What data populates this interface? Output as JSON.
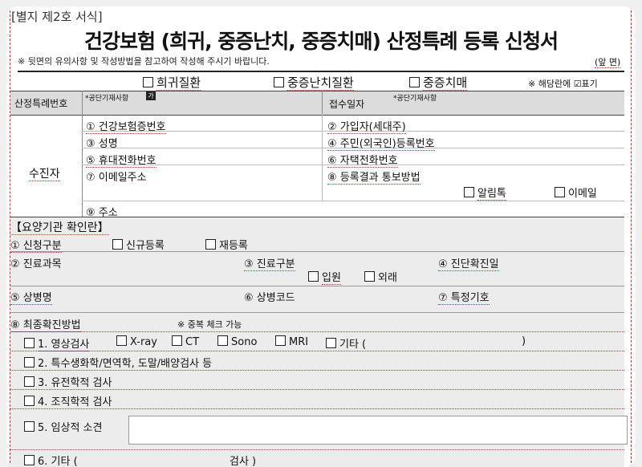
{
  "form_label": "[별지 제2호 서식]",
  "title": "건강보험 (희귀, 중증난치, 중증치매) 산정특례 등록 신청서",
  "note": "※ 뒷면의 유의사항 및 작성방법을 참고하여 작성해 주시기 바랍니다.",
  "page_side": "(앞 면)",
  "disease_types": [
    "희귀질환",
    "중증난치질환",
    "중증치매"
  ],
  "check_hint": "※ 해당란에 ☑표기",
  "special_case_no_label": "산정특례번호",
  "public_entry_1": "*공단기재사항",
  "receipt_date_label": "접수일자",
  "public_entry_2": "*공단기재사항",
  "recipient_label": "수진자",
  "fields": {
    "f1": "① 건강보험증번호",
    "f2": "② 가입자(세대주)",
    "f3": "③ 성명",
    "f4": "④ 주민(외국인)등록번호",
    "f5": "⑤ 휴대전화번호",
    "f6": "⑥ 자택전화번호",
    "f7": "⑦ 이메일주소",
    "f8": "⑧ 등록결과 통보방법",
    "f8_opt1": "알림톡",
    "f8_opt2": "이메일",
    "f9": "⑨ 주소"
  },
  "clinic_section": "【요양기관 확인란】",
  "clinic": {
    "req_type": "① 신청구분",
    "new_reg": "신규등록",
    "re_reg": "재등록",
    "dept": "② 진료과목",
    "care_type": "③ 진료구분",
    "inpatient": "입원",
    "outpatient": "외래",
    "diag_date": "④ 진단확진일",
    "disease_name": "⑤ 상병명",
    "disease_code": "⑥ 상병코드",
    "special_symbol": "⑦ 특정기호",
    "confirm_method": "⑧ 최종확진방법",
    "multi_check": "※ 중복 체크 가능"
  },
  "methods": {
    "m1": "1. 영상검사",
    "m1_opts": [
      "X-ray",
      "CT",
      "Sono",
      "MRI"
    ],
    "m1_etc": "기타 (",
    "m1_close": ")",
    "m2": "2. 특수생화학/면역학, 도말/배양검사 등",
    "m3": "3. 유전학적 검사",
    "m4": "4. 조직학적 검사",
    "m5": "5. 임상적 소견",
    "m6": "6. 기타 (",
    "m6_tail": "검사 )"
  }
}
